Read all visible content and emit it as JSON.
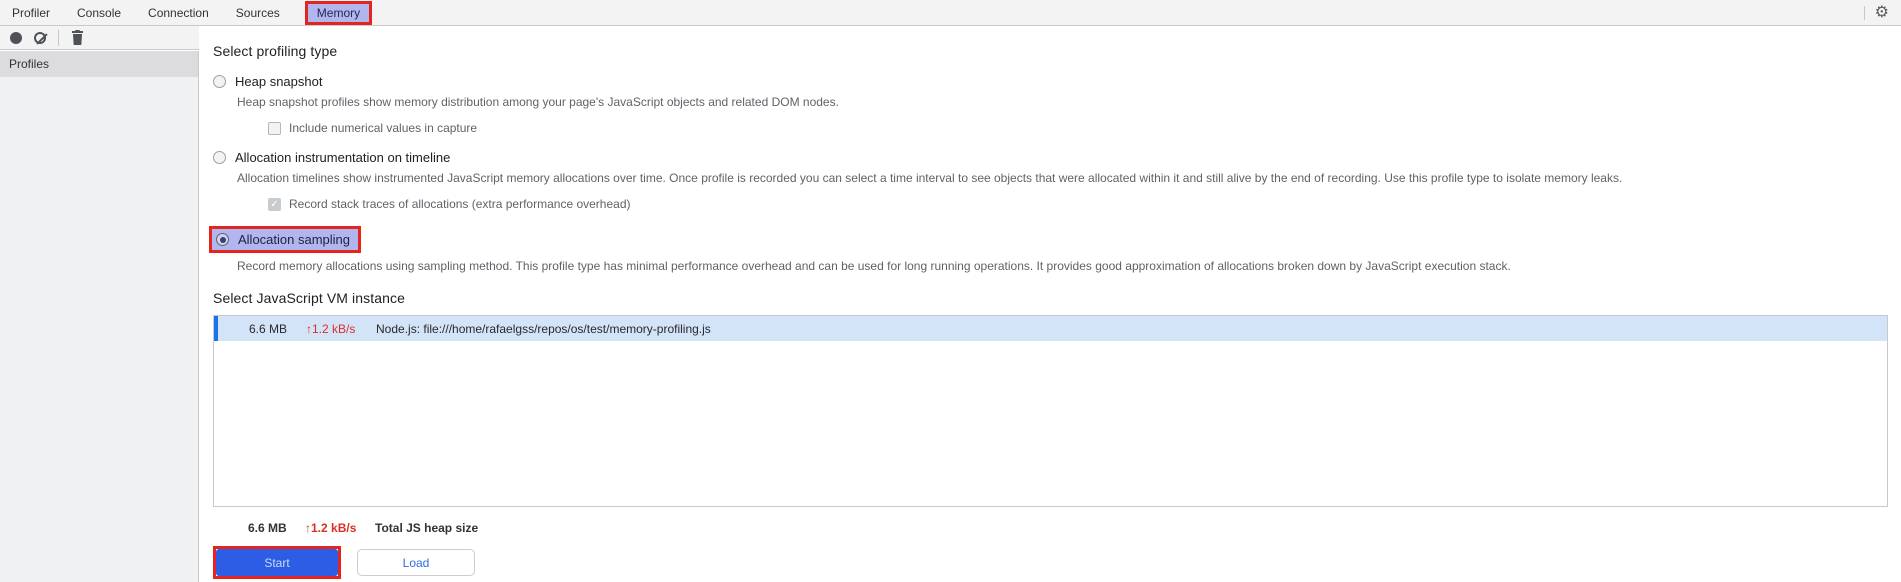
{
  "tabs": {
    "items": [
      {
        "label": "Profiler"
      },
      {
        "label": "Console"
      },
      {
        "label": "Connection"
      },
      {
        "label": "Sources"
      },
      {
        "label": "Memory",
        "active": true,
        "annotated": true
      }
    ]
  },
  "icons": {
    "settings": "⚙",
    "check": "✓",
    "record": "record-circle",
    "clear": "block-circle",
    "trash": "trash-can"
  },
  "sidebar": {
    "header": "Profiles"
  },
  "profiling": {
    "title": "Select profiling type",
    "options": [
      {
        "label": "Heap snapshot",
        "selected": false,
        "description": "Heap snapshot profiles show memory distribution among your page's JavaScript objects and related DOM nodes.",
        "sub_checkbox": {
          "label": "Include numerical values in capture",
          "checked": false
        }
      },
      {
        "label": "Allocation instrumentation on timeline",
        "selected": false,
        "description": "Allocation timelines show instrumented JavaScript memory allocations over time. Once profile is recorded you can select a time interval to see objects that were allocated within it and still alive by the end of recording. Use this profile type to isolate memory leaks.",
        "sub_checkbox": {
          "label": "Record stack traces of allocations (extra performance overhead)",
          "checked": true,
          "disabled": true
        }
      },
      {
        "label": "Allocation sampling",
        "selected": true,
        "annotated": true,
        "description": "Record memory allocations using sampling method. This profile type has minimal performance overhead and can be used for long running operations. It provides good approximation of allocations broken down by JavaScript execution stack."
      }
    ]
  },
  "vm": {
    "title": "Select JavaScript VM instance",
    "rows": [
      {
        "heap_size": "6.6 MB",
        "rate": "↑1.2 kB/s",
        "name": "Node.js: file:///home/rafaelgss/repos/os/test/memory-profiling.js",
        "selected": true
      }
    ],
    "total": {
      "heap_size": "6.6 MB",
      "rate": "↑1.2 kB/s",
      "label": "Total JS heap size"
    }
  },
  "actions": {
    "start": "Start",
    "load": "Load"
  },
  "colors": {
    "accent_blue": "#1a73e8",
    "annotation_red": "#e3241f",
    "highlight_lavender": "#b1b6ee",
    "selected_row_bg": "#d4e4f8",
    "row_accent": "#1a73e8",
    "stat_red": "#d93025",
    "start_btn_bg": "#2d5ce5",
    "start_btn_text": "#cdd8fb",
    "load_btn_text": "#2f6ae1",
    "tabbar_bg": "#f3f3f3",
    "sidebar_bg": "#f0f1f3",
    "sidebar_header_bg": "#dcdcde",
    "border_gray": "#c9c9cb",
    "text_primary": "#202124",
    "text_secondary": "#5f6368"
  }
}
